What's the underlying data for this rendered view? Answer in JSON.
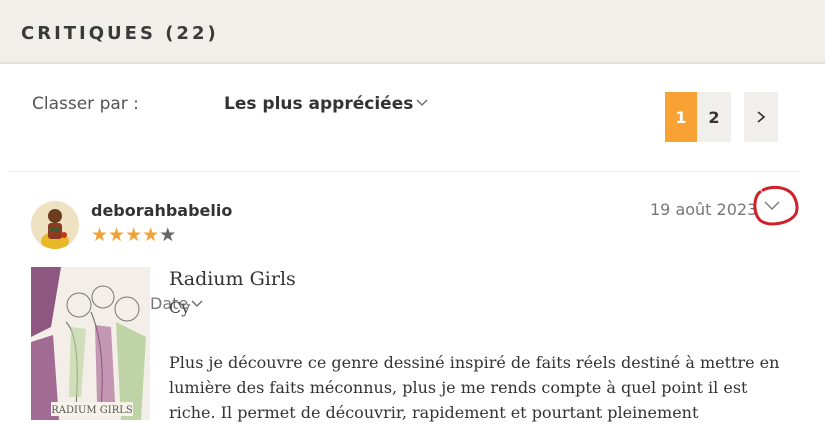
{
  "header": {
    "title": "CRITIQUES (22)"
  },
  "sort": {
    "label": "Classer par :",
    "options": [
      "Date",
      "Les plus appréciées"
    ],
    "selected": "Les plus appréciées"
  },
  "pagination": {
    "pages": [
      "1",
      "2"
    ],
    "current": "1",
    "next_icon": "chevron-right-icon"
  },
  "review": {
    "username": "deborahbabelio",
    "rating": 4,
    "rating_max": 5,
    "date": "19 août 2023",
    "book_title": "Radium Girls",
    "book_author": "Cy",
    "cover_text": "RADIUM GIRLS",
    "text": "Plus je découvre ce genre dessiné inspiré de faits réels destiné à mettre en lumière des faits méconnus, plus je me rends compte à quel point il est riche. Il permet de découvrir, rapidement et pourtant pleinement"
  },
  "colors": {
    "accent": "#f7a233",
    "header_bg": "#f2efea",
    "annotation": "#d0202a",
    "star": "#f0a33a"
  }
}
